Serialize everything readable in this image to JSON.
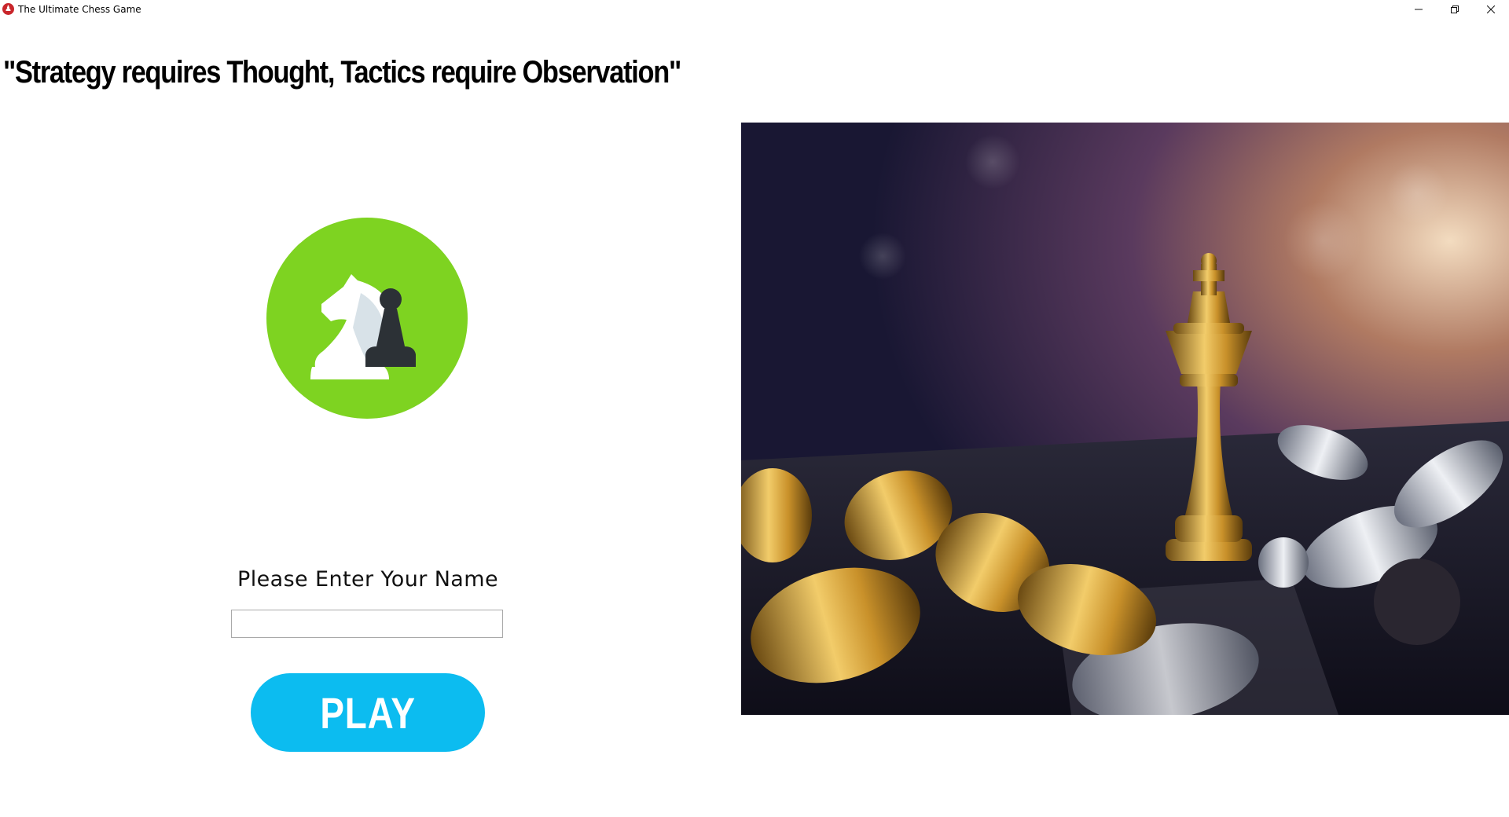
{
  "window": {
    "title": "The Ultimate Chess Game",
    "icon": "chess-pawn-icon",
    "controls": [
      "minimize",
      "restore",
      "close"
    ]
  },
  "main": {
    "quote": "\"Strategy requires Thought, Tactics require Observation\"",
    "logo": "knight-and-pawn-logo",
    "name_prompt": "Please Enter Your Name",
    "name_value": "",
    "play_label": "PLAY",
    "image": "golden-king-among-fallen-chess-pieces"
  },
  "colors": {
    "logo_green": "#7ed321",
    "play_blue": "#0cbcf0",
    "app_icon_red": "#c9262b"
  }
}
